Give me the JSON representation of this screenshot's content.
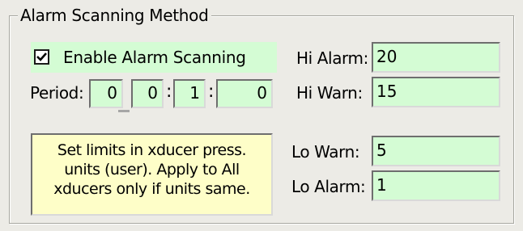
{
  "group": {
    "title": "Alarm Scanning Method"
  },
  "enable": {
    "label": "Enable Alarm Scanning",
    "checked": true,
    "icon": "checkmark-icon"
  },
  "period": {
    "label": "Period:",
    "fields": [
      "0",
      "0",
      "1",
      "0"
    ],
    "separators": [
      ":",
      ":"
    ]
  },
  "note": {
    "lines": [
      "Set limits in xducer press.",
      "units (user). Apply to All",
      "xducers only if units same."
    ]
  },
  "alarms": {
    "hi_alarm": {
      "label": "Hi Alarm:",
      "value": "20"
    },
    "hi_warn": {
      "label": "Hi Warn:",
      "value": "15"
    },
    "lo_warn": {
      "label": "Lo Warn:",
      "value": "5"
    },
    "lo_alarm": {
      "label": "Lo Alarm:",
      "value": "1"
    }
  },
  "colors": {
    "field_bg": "#d4fcd4",
    "note_bg": "#fefec8",
    "window_bg": "#ecebe6"
  }
}
